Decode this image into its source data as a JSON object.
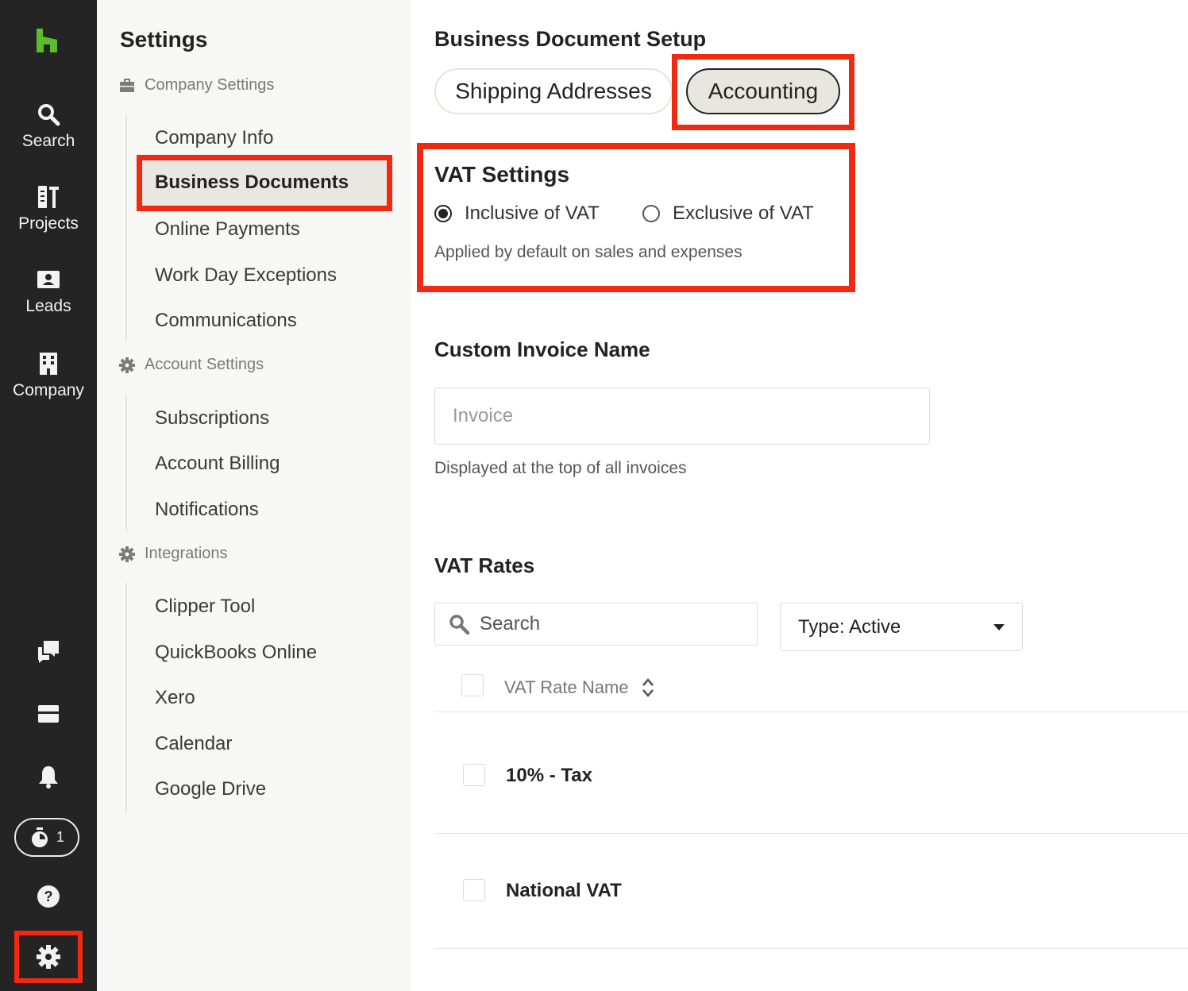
{
  "rail": {
    "items": [
      {
        "label": "Search",
        "icon": "search-icon"
      },
      {
        "label": "Projects",
        "icon": "projects-icon"
      },
      {
        "label": "Leads",
        "icon": "leads-icon"
      },
      {
        "label": "Company",
        "icon": "company-icon"
      }
    ],
    "timer_count": "1"
  },
  "sidebar": {
    "title": "Settings",
    "groups": [
      {
        "label": "Company Settings",
        "items": [
          "Company Info",
          "Business Documents",
          "Online Payments",
          "Work Day Exceptions",
          "Communications"
        ]
      },
      {
        "label": "Account Settings",
        "items": [
          "Subscriptions",
          "Account Billing",
          "Notifications"
        ]
      },
      {
        "label": "Integrations",
        "items": [
          "Clipper Tool",
          "QuickBooks Online",
          "Xero",
          "Calendar",
          "Google Drive"
        ]
      }
    ],
    "active_item": "Business Documents"
  },
  "main": {
    "title": "Business Document Setup",
    "tabs": [
      "Shipping Addresses",
      "Accounting"
    ],
    "active_tab": "Accounting",
    "vat_settings": {
      "title": "VAT Settings",
      "options": [
        "Inclusive of VAT",
        "Exclusive of VAT"
      ],
      "selected": "Inclusive of VAT",
      "help": "Applied by default on sales and expenses"
    },
    "custom_invoice": {
      "title": "Custom Invoice Name",
      "placeholder": "Invoice",
      "help": "Displayed at the top of all invoices"
    },
    "vat_rates": {
      "title": "VAT Rates",
      "search_placeholder": "Search",
      "type_filter": "Type: Active",
      "column_header": "VAT Rate Name",
      "rows": [
        "10% - Tax",
        "National VAT"
      ]
    }
  },
  "colors": {
    "rail_bg": "#242424",
    "highlight": "#f02a12",
    "logo_green": "#5bbd2b",
    "sidebar_bg": "#f7f7f5"
  }
}
